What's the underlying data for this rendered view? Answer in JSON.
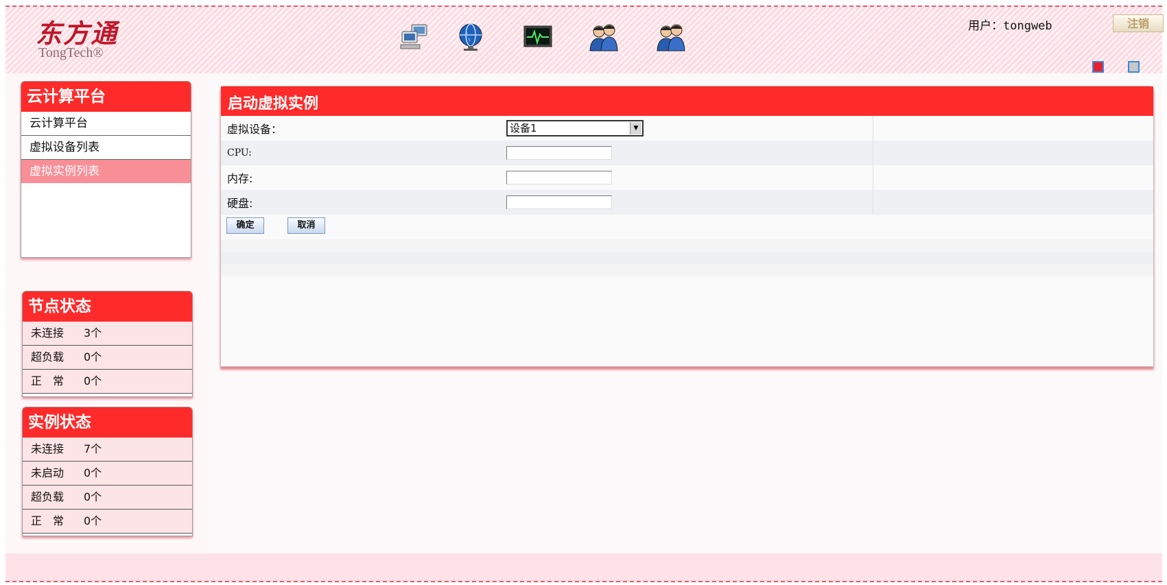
{
  "header": {
    "logo_cn": "东方通",
    "logo_en": "TongTech®",
    "nav_icons": [
      "network-computers-icon",
      "globe-icon",
      "monitor-pulse-icon",
      "users-icon",
      "user-group-icon"
    ],
    "user_label": "用户：",
    "username": "tongweb",
    "logout_label": "注销",
    "skin_colors": [
      "#e82030",
      "#c8c8c8"
    ]
  },
  "sidebar": {
    "platform": {
      "title": "云计算平台",
      "items": [
        {
          "label": "云计算平台"
        },
        {
          "label": "虚拟设备列表"
        },
        {
          "label": "虚拟实例列表"
        }
      ],
      "active_index": 2
    },
    "node_status": {
      "title": "节点状态",
      "rows": [
        {
          "label": "未连接",
          "count": "3个"
        },
        {
          "label": "超负载",
          "count": "0个"
        },
        {
          "label": "正　常",
          "count": "0个"
        }
      ]
    },
    "instance_status": {
      "title": "实例状态",
      "rows": [
        {
          "label": "未连接",
          "count": "7个"
        },
        {
          "label": "未启动",
          "count": "0个"
        },
        {
          "label": "超负载",
          "count": "0个"
        },
        {
          "label": "正　常",
          "count": "0个"
        }
      ]
    }
  },
  "main": {
    "title": "启动虚拟实例",
    "form": {
      "device_label": "虚拟设备：",
      "device_value": "设备1",
      "cpu_label": "CPU:",
      "cpu_value": "",
      "memory_label": "内存:",
      "memory_value": "",
      "disk_label": "硬盘:",
      "disk_value": ""
    },
    "confirm_label": "确定",
    "cancel_label": "取消"
  },
  "colors": {
    "accent_red": "#ff2a2a",
    "active_item": "#f98f96",
    "header_bg": "#fde3e8"
  }
}
